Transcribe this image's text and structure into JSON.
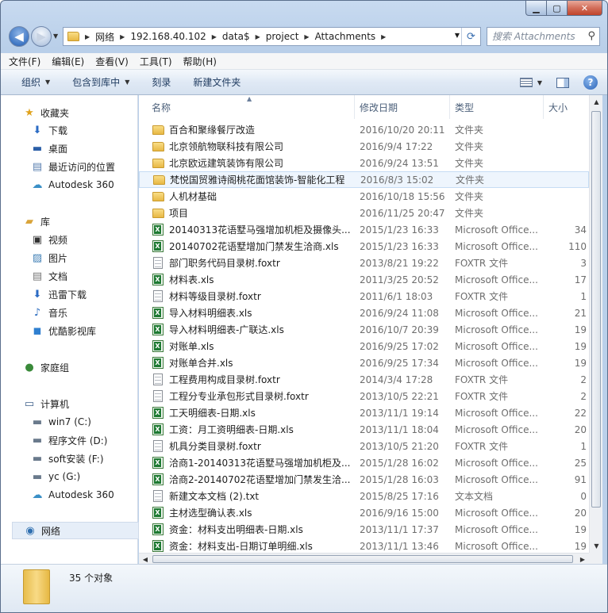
{
  "address": {
    "crumbs": [
      "网络",
      "192.168.40.102",
      "data$",
      "project",
      "Attachments"
    ]
  },
  "search": {
    "placeholder": "搜索 Attachments"
  },
  "menu": [
    "文件(F)",
    "编辑(E)",
    "查看(V)",
    "工具(T)",
    "帮助(H)"
  ],
  "toolbar": {
    "organize": "组织",
    "include_library": "包含到库中",
    "burn": "刻录",
    "new_folder": "新建文件夹"
  },
  "nav": {
    "favorites": "收藏夹",
    "fav_items": [
      "下载",
      "桌面",
      "最近访问的位置",
      "Autodesk 360"
    ],
    "libraries": "库",
    "lib_items": [
      "视频",
      "图片",
      "文档",
      "迅雷下载",
      "音乐",
      "优酷影视库"
    ],
    "homegroup": "家庭组",
    "computer": "计算机",
    "comp_items": [
      "win7 (C:)",
      "程序文件 (D:)",
      "soft安装 (F:)",
      "yc (G:)",
      "Autodesk 360"
    ],
    "network": "网络"
  },
  "columns": {
    "name": "名称",
    "date": "修改日期",
    "type": "类型",
    "size": "大小"
  },
  "files": [
    {
      "name": "百合和聚缘餐厅改造",
      "date": "2016/10/20 20:11",
      "type": "文件夹",
      "size": "",
      "icon": "folder"
    },
    {
      "name": "北京领航物联科技有限公司",
      "date": "2016/9/4 17:22",
      "type": "文件夹",
      "size": "",
      "icon": "folder"
    },
    {
      "name": "北京欧远建筑装饰有限公司",
      "date": "2016/9/24 13:51",
      "type": "文件夹",
      "size": "",
      "icon": "folder"
    },
    {
      "name": "梵悦国贸雅诗阁桃花面馆装饰-智能化工程",
      "date": "2016/8/3 15:02",
      "type": "文件夹",
      "size": "",
      "icon": "folder",
      "selected": true
    },
    {
      "name": "人机材基础",
      "date": "2016/10/18 15:56",
      "type": "文件夹",
      "size": "",
      "icon": "folder"
    },
    {
      "name": "项目",
      "date": "2016/11/25 20:47",
      "type": "文件夹",
      "size": "",
      "icon": "folder"
    },
    {
      "name": "20140313花语墅马强增加机柜及摄像头...",
      "date": "2015/1/23 16:33",
      "type": "Microsoft Office...",
      "size": "34",
      "icon": "xls"
    },
    {
      "name": "20140702花语墅增加门禁发生洽商.xls",
      "date": "2015/1/23 16:33",
      "type": "Microsoft Office...",
      "size": "110",
      "icon": "xls"
    },
    {
      "name": "部门职务代码目录树.foxtr",
      "date": "2013/8/21 19:22",
      "type": "FOXTR 文件",
      "size": "3",
      "icon": "doc"
    },
    {
      "name": "材料表.xls",
      "date": "2011/3/25 20:52",
      "type": "Microsoft Office...",
      "size": "17",
      "icon": "xls"
    },
    {
      "name": "材料等级目录树.foxtr",
      "date": "2011/6/1 18:03",
      "type": "FOXTR 文件",
      "size": "1",
      "icon": "doc"
    },
    {
      "name": "导入材料明细表.xls",
      "date": "2016/9/24 11:08",
      "type": "Microsoft Office...",
      "size": "21",
      "icon": "xls"
    },
    {
      "name": "导入材料明细表-广联达.xls",
      "date": "2016/10/7 20:39",
      "type": "Microsoft Office...",
      "size": "19",
      "icon": "xls"
    },
    {
      "name": "对账单.xls",
      "date": "2016/9/25 17:02",
      "type": "Microsoft Office...",
      "size": "19",
      "icon": "xls"
    },
    {
      "name": "对账单合并.xls",
      "date": "2016/9/25 17:34",
      "type": "Microsoft Office...",
      "size": "19",
      "icon": "xls"
    },
    {
      "name": "工程费用构成目录树.foxtr",
      "date": "2014/3/4 17:28",
      "type": "FOXTR 文件",
      "size": "2",
      "icon": "doc"
    },
    {
      "name": "工程分专业承包形式目录树.foxtr",
      "date": "2013/10/5 22:21",
      "type": "FOXTR 文件",
      "size": "2",
      "icon": "doc"
    },
    {
      "name": "工天明细表-日期.xls",
      "date": "2013/11/1 19:14",
      "type": "Microsoft Office...",
      "size": "22",
      "icon": "xls"
    },
    {
      "name": "工资：月工资明细表-日期.xls",
      "date": "2013/11/1 18:04",
      "type": "Microsoft Office...",
      "size": "20",
      "icon": "xls"
    },
    {
      "name": "机具分类目录树.foxtr",
      "date": "2013/10/5 21:20",
      "type": "FOXTR 文件",
      "size": "1",
      "icon": "doc"
    },
    {
      "name": "洽商1-20140313花语墅马强增加机柜及...",
      "date": "2015/1/28 16:02",
      "type": "Microsoft Office...",
      "size": "25",
      "icon": "xls"
    },
    {
      "name": "洽商2-20140702花语墅增加门禁发生洽...",
      "date": "2015/1/28 16:03",
      "type": "Microsoft Office...",
      "size": "91",
      "icon": "xls"
    },
    {
      "name": "新建文本文档 (2).txt",
      "date": "2015/8/25 17:16",
      "type": "文本文档",
      "size": "0",
      "icon": "doc"
    },
    {
      "name": "主材选型确认表.xls",
      "date": "2016/9/16 15:00",
      "type": "Microsoft Office...",
      "size": "20",
      "icon": "xls"
    },
    {
      "name": "资金：材料支出明细表-日期.xls",
      "date": "2013/11/1 17:37",
      "type": "Microsoft Office...",
      "size": "19",
      "icon": "xls"
    },
    {
      "name": "资金：材料支出-日期订单明细.xls",
      "date": "2013/11/1 13:46",
      "type": "Microsoft Office...",
      "size": "19",
      "icon": "xls"
    }
  ],
  "status": {
    "count": "35 个对象"
  }
}
